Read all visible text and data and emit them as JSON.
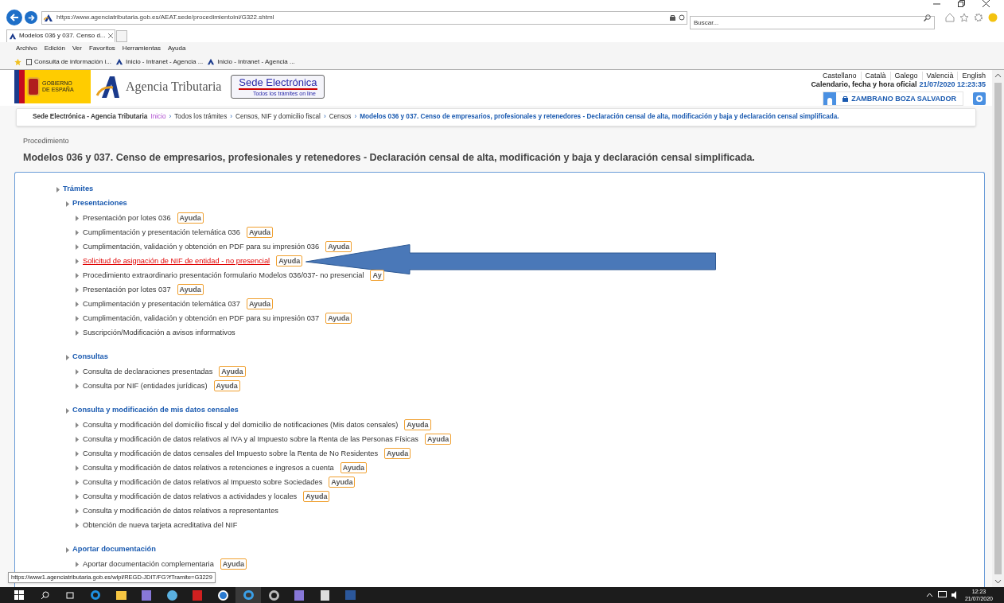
{
  "browser": {
    "address": "https://www.agenciatributaria.gob.es/AEAT.sede/procedimientoini/G322.shtml",
    "search_placeholder": "Buscar...",
    "tabs": [
      {
        "label": "Modelos 036 y 037. Censo d...",
        "selected": true
      }
    ],
    "menu": [
      "Archivo",
      "Edición",
      "Ver",
      "Favoritos",
      "Herramientas",
      "Ayuda"
    ],
    "favorites": [
      "Consulta de información i...",
      "Inicio - Intranet - Agencia ...",
      "Inicio - Intranet - Agencia ..."
    ]
  },
  "header": {
    "gov_label": "GOBIERNO DE ESPAÑA",
    "agency": "Agencia Tributaria",
    "sede_title": "Sede Electrónica",
    "sede_subtitle": "Todos los trámites on line",
    "languages": [
      "Castellano",
      "Català",
      "Galego",
      "Valencià",
      "English"
    ],
    "calendar_label": "Calendario, fecha y hora oficial",
    "calendar_value": "21/07/2020 12:23:35",
    "user": "ZAMBRANO BOZA SALVADOR"
  },
  "breadcrumb": [
    {
      "label": "Sede Electrónica - Agencia Tributaria",
      "kind": "site"
    },
    {
      "label": "Inicio",
      "kind": "visited"
    },
    {
      "label": "›",
      "kind": "separator"
    },
    {
      "label": "Todos los trámites",
      "kind": "link"
    },
    {
      "label": "›",
      "kind": "separator"
    },
    {
      "label": "Censos, NIF y domicilio fiscal",
      "kind": "link"
    },
    {
      "label": "›",
      "kind": "separator"
    },
    {
      "label": "Censos",
      "kind": "link"
    },
    {
      "label": "›",
      "kind": "separator"
    },
    {
      "label": "Modelos 036 y 037. Censo de empresarios, profesionales y retenedores - Declaración censal de alta, modificación y baja y declaración censal simplificada.",
      "kind": "current"
    }
  ],
  "page": {
    "kicker": "Procedimiento",
    "title": "Modelos 036 y 037. Censo de empresarios, profesionales y retenedores - Declaración censal de alta, modificación y baja y declaración censal simplificada."
  },
  "tree": [
    {
      "label": "Trámites",
      "children": [
        {
          "label": "Presentaciones",
          "children": [
            {
              "label": "Presentación por lotes 036",
              "help": "Ayuda",
              "hovered": false
            },
            {
              "label": "Cumplimentación y presentación telemática 036",
              "help": "Ayuda",
              "hovered": false
            },
            {
              "label": "Cumplimentación, validación y obtención en PDF para su impresión 036",
              "help": "Ayuda",
              "hovered": false
            },
            {
              "label": "Solicitud de asignación de NIF de entidad - no presencial",
              "help": "Ayuda",
              "hovered": true
            },
            {
              "label": "Procedimiento extraordinario presentación formulario Modelos 036/037- no presencial",
              "help": "Ay",
              "hovered": false
            },
            {
              "label": "Presentación por lotes 037",
              "help": "Ayuda",
              "hovered": false
            },
            {
              "label": "Cumplimentación y presentación telemática 037",
              "help": "Ayuda",
              "hovered": false
            },
            {
              "label": "Cumplimentación, validación y obtención en PDF para su impresión 037",
              "help": "Ayuda",
              "hovered": false
            },
            {
              "label": "Suscripción/Modificación a avisos informativos",
              "hovered": false
            }
          ]
        },
        {
          "label": "Consultas",
          "children": [
            {
              "label": "Consulta de declaraciones presentadas",
              "help": "Ayuda",
              "hovered": false
            },
            {
              "label": "Consulta por NIF (entidades jurídicas)",
              "help": "Ayuda",
              "hovered": false
            }
          ]
        },
        {
          "label": "Consulta y modificación de mis datos censales",
          "children": [
            {
              "label": "Consulta y modificación del domicilio fiscal y del domicilio de notificaciones (Mis datos censales)",
              "help": "Ayuda",
              "hovered": false
            },
            {
              "label": "Consulta y modificación de datos relativos al IVA y al Impuesto sobre la Renta de las Personas Físicas",
              "help": "Ayuda",
              "hovered": false
            },
            {
              "label": "Consulta y modificación de datos censales del Impuesto sobre la Renta de No Residentes",
              "help": "Ayuda",
              "hovered": false
            },
            {
              "label": "Consulta y modificación de datos relativos a retenciones e ingresos a cuenta",
              "help": "Ayuda",
              "hovered": false
            },
            {
              "label": "Consulta y modificación de datos relativos al Impuesto sobre Sociedades",
              "help": "Ayuda",
              "hovered": false
            },
            {
              "label": "Consulta y modificación de datos relativos a actividades y locales",
              "help": "Ayuda",
              "hovered": false
            },
            {
              "label": "Consulta y modificación de datos relativos a representantes",
              "hovered": false
            },
            {
              "label": "Obtención de nueva tarjeta acreditativa del NIF",
              "hovered": false
            }
          ]
        },
        {
          "label": "Aportar documentación",
          "children": [
            {
              "label": "Aportar documentación complementaria",
              "help": "Ayuda",
              "hovered": false
            }
          ]
        }
      ]
    }
  ],
  "status_url": "https://www1.agenciatributaria.gob.es/wlpl/REGD-JDIT/FG?fTramite=G3229",
  "taskbar": {
    "time": "12:23",
    "date": "21/07/2020"
  }
}
